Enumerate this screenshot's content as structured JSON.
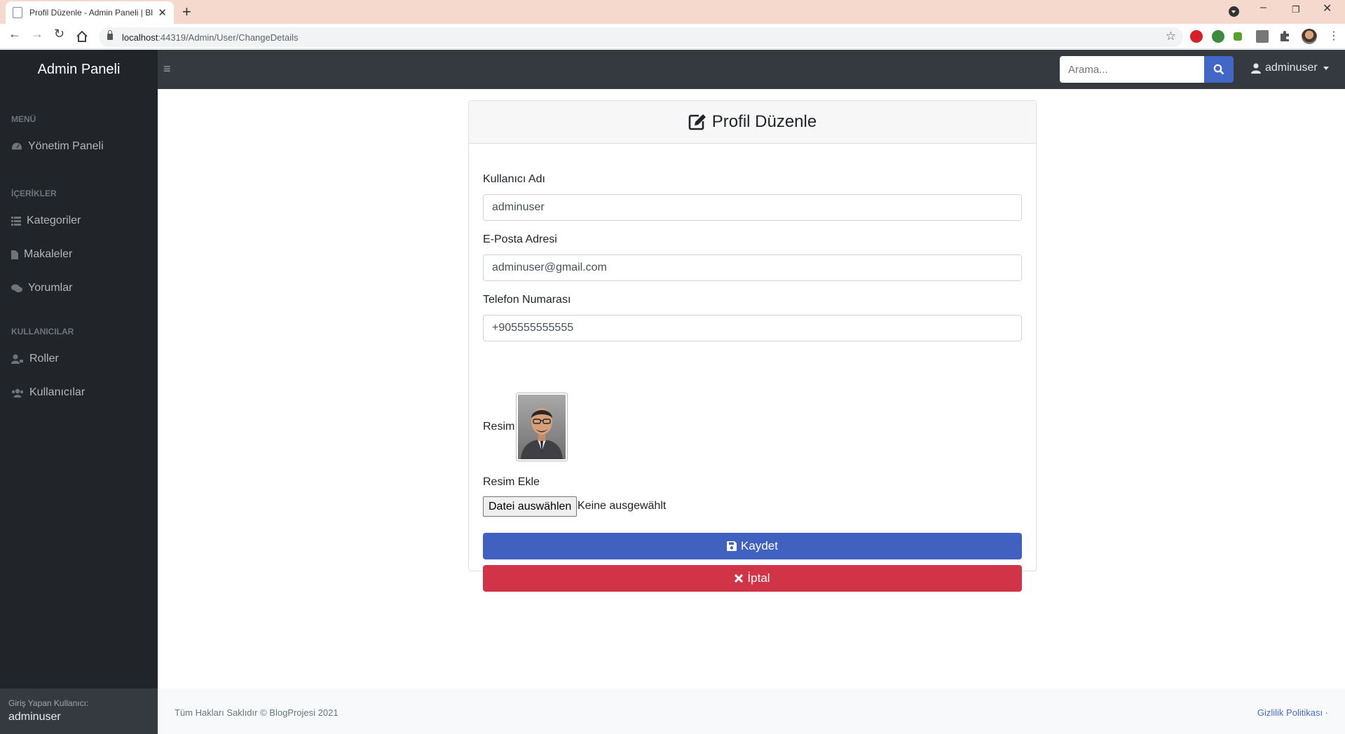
{
  "browser": {
    "tab_title": "Profil Düzenle - Admin Paneli | Bl",
    "url_host": "localhost",
    "url_rest": ":44319/Admin/User/ChangeDetails"
  },
  "app": {
    "brand": "Admin Paneli",
    "search_placeholder": "Arama...",
    "user_menu_label": "adminuser"
  },
  "sidebar": {
    "sections": [
      {
        "heading": "MENÜ",
        "items": [
          {
            "label": "Yönetim Paneli",
            "icon": "dashboard-icon"
          }
        ]
      },
      {
        "heading": "İÇERİKLER",
        "items": [
          {
            "label": "Kategoriler",
            "icon": "list-icon"
          },
          {
            "label": "Makaleler",
            "icon": "file-icon"
          },
          {
            "label": "Yorumlar",
            "icon": "comments-icon"
          }
        ]
      },
      {
        "heading": "KULLANICILAR",
        "items": [
          {
            "label": "Roller",
            "icon": "user-tag-icon"
          },
          {
            "label": "Kullanıcılar",
            "icon": "users-icon"
          }
        ]
      }
    ],
    "footer_label": "Giriş Yapan Kullanıcı:",
    "footer_user": "adminuser"
  },
  "form": {
    "title": "Profil Düzenle",
    "username_label": "Kullanıcı Adı",
    "username_value": "adminuser",
    "email_label": "E-Posta Adresi",
    "email_value": "adminuser@gmail.com",
    "phone_label": "Telefon Numarası",
    "phone_value": "+905555555555",
    "picture_label": "Resim",
    "add_picture_label": "Resim Ekle",
    "file_button": "Datei auswählen",
    "file_status": "Keine ausgewählt",
    "save_button": "Kaydet",
    "cancel_button": "İptal"
  },
  "footer": {
    "copyright": "Tüm Hakları Saklıdır © BlogProjesi 2021",
    "privacy_link": "Gizlilik Politikası ·"
  },
  "colors": {
    "topnav": "#343a40",
    "sidebar": "#212529",
    "primary": "#4061c0",
    "danger": "#d13447",
    "tab_strip": "#f6d9cd"
  }
}
